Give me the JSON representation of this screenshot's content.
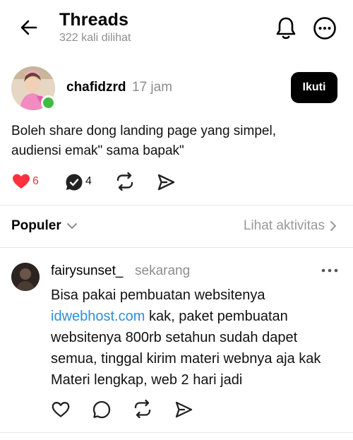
{
  "header": {
    "title": "Threads",
    "subtitle": "322 kali dilihat",
    "back_icon": "arrow-left-icon",
    "bell_icon": "bell-icon",
    "more_icon": "more-circle-icon"
  },
  "post": {
    "username": "chafidzrd",
    "time": "17 jam",
    "follow_label": "Ikuti",
    "online": true,
    "text_line1": "Boleh share dong landing page yang simpel,",
    "text_line2": "audiensi emak\" sama bapak\"",
    "like_count": "6",
    "reply_count": "4",
    "liked": true
  },
  "filter": {
    "sort_label": "Populer",
    "activity_label": "Lihat aktivitas"
  },
  "reply": {
    "username": "fairysunset_",
    "time": "sekarang",
    "line1": "Bisa pakai pembuatan websitenya",
    "link": "idwebhost.com",
    "line2_rest": " kak, paket pembuatan",
    "line3": "websitenya 800rb setahun sudah dapet",
    "line4": "semua, tinggal kirim materi webnya aja kak",
    "line5": "Materi lengkap, web 2 hari jadi"
  },
  "colors": {
    "like_red": "#ff3040",
    "link_blue": "#2e8fd8",
    "online_green": "#3fbd3f",
    "muted_gray": "#8e8e8e"
  }
}
